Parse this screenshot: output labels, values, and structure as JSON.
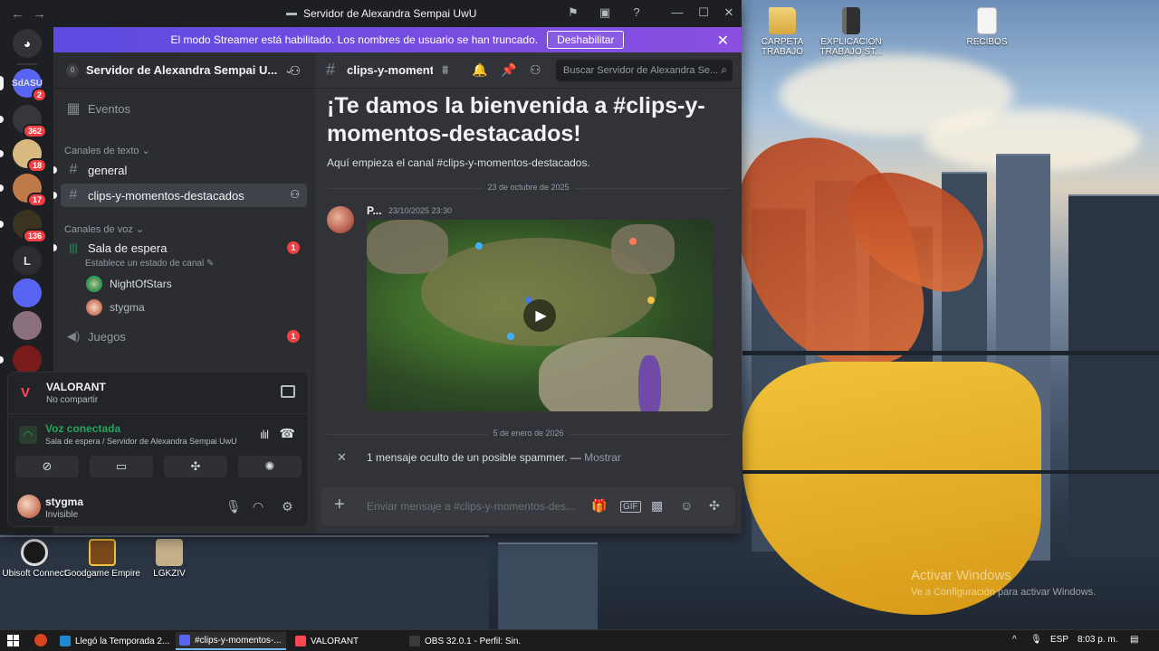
{
  "window": {
    "title": "Servidor de Alexandra Sempai UwU"
  },
  "streamer_banner": {
    "text": "El modo Streamer está habilitado. Los nombres de usuario se han truncado.",
    "button": "Deshabilitar"
  },
  "servers": [
    {
      "label": "SdASU",
      "badge": "2",
      "color": "#5865f2"
    },
    {
      "label": "",
      "badge": "362",
      "color": "#35373c"
    },
    {
      "label": "",
      "badge": "18",
      "color": "#d9b982"
    },
    {
      "label": "",
      "badge": "17",
      "color": "#c07a4a"
    },
    {
      "label": "",
      "badge": "136",
      "color": "#3a3320"
    },
    {
      "label": "L",
      "badge": "",
      "color": "#2b2d31"
    },
    {
      "label": "",
      "badge": "",
      "color": "#5865f2"
    },
    {
      "label": "",
      "badge": "",
      "color": "#8a6f7c"
    },
    {
      "label": "",
      "badge": "",
      "color": "#7a1b1b"
    }
  ],
  "sidebar": {
    "server_name": "Servidor de Alexandra Sempai U...",
    "events": "Eventos",
    "text_category": "Canales de texto",
    "text_channels": [
      {
        "name": "general"
      },
      {
        "name": "clips-y-momentos-destacados"
      }
    ],
    "voice_category": "Canales de voz",
    "voice_channel": {
      "name": "Sala de espera",
      "status": "Establece un estado de canal",
      "badge": "1"
    },
    "voice_users": [
      "NightOfStars",
      "stygma"
    ],
    "voice_channel2": {
      "name": "Juegos",
      "badge": "1"
    }
  },
  "activity": {
    "game": "VALORANT",
    "game_sub": "No compartir"
  },
  "voice": {
    "status": "Voz conectada",
    "location": "Sala de espera / Servidor de Alexandra Sempai UwU"
  },
  "user": {
    "name": "stygma",
    "status": "Invisible"
  },
  "channel_header": {
    "name": "clips-y-momentos-destacados",
    "search_placeholder": "Buscar Servidor de Alexandra Se..."
  },
  "messages": {
    "welcome_title": "¡Te damos la bienvenida a #clips-y-momentos-destacados!",
    "welcome_sub": "Aquí empieza el canal #clips-y-momentos-destacados.",
    "date1": "23 de octubre de 2025",
    "author": "P...",
    "timestamp": "23/10/2025 23:30",
    "date2": "5 de enero de 2026",
    "spam_text": "1 mensaje oculto de un posible spammer. —",
    "spam_show": "Mostrar"
  },
  "composer": {
    "placeholder": "Enviar mensaje a #clips-y-momentos-des..."
  },
  "desktop_icons": [
    {
      "label": "CARPETA TRABAJO",
      "kind": "folder"
    },
    {
      "label": "EXPLICACION TRABAJO ST...",
      "kind": "book"
    },
    {
      "label": "RECIBOS",
      "kind": "doc"
    },
    {
      "label": "Ubisoft Connect",
      "kind": "ubi"
    },
    {
      "label": "Goodgame Empire",
      "kind": "gge"
    },
    {
      "label": "LGKZIV",
      "kind": "lgk"
    }
  ],
  "watermark": {
    "line1": "Activar Windows",
    "line2": "Ve a Configuración para activar Windows."
  },
  "taskbar": {
    "apps": [
      {
        "label": "Llegó la Temporada 2...",
        "color": "#1f8ad1"
      },
      {
        "label": "#clips-y-momentos-...",
        "color": "#5865f2"
      },
      {
        "label": "VALORANT",
        "color": "#ff4655"
      },
      {
        "label": "OBS 32.0.1 - Perfil: Sin...",
        "color": "#3a3a3a"
      }
    ],
    "lang": "ESP",
    "time": "8:03 p. m."
  }
}
